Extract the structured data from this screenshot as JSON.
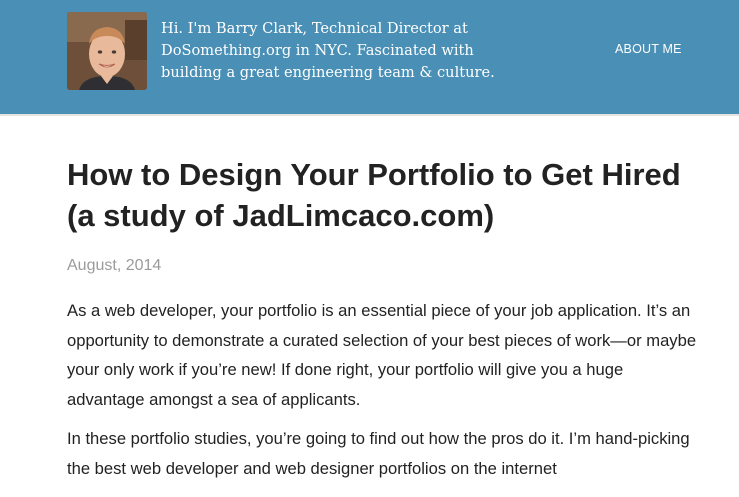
{
  "header": {
    "avatar_alt": "Barry Clark",
    "description": "Hi. I'm Barry Clark, Technical Director at DoSomething.org in NYC. Fascinated with building a great engineering team & culture.",
    "nav": {
      "about_label": "ABOUT ME"
    },
    "colors": {
      "background": "#4a8fb5",
      "text": "#ffffff"
    }
  },
  "post": {
    "title": "How to Design Your Portfolio to Get Hired (a study of JadLimcaco.com)",
    "date": "August, 2014",
    "paragraphs": [
      "As a web developer, your portfolio is an essential piece of your job application. It’s an opportunity to demonstrate a curated selection of your best pieces of work—or maybe your only work if you’re new! If done right, your portfolio will give you a huge advantage amongst a sea of applicants.",
      "In these portfolio studies, you’re going to find out how the pros do it. I’m hand-picking the best web developer and web designer portfolios on the internet"
    ]
  }
}
